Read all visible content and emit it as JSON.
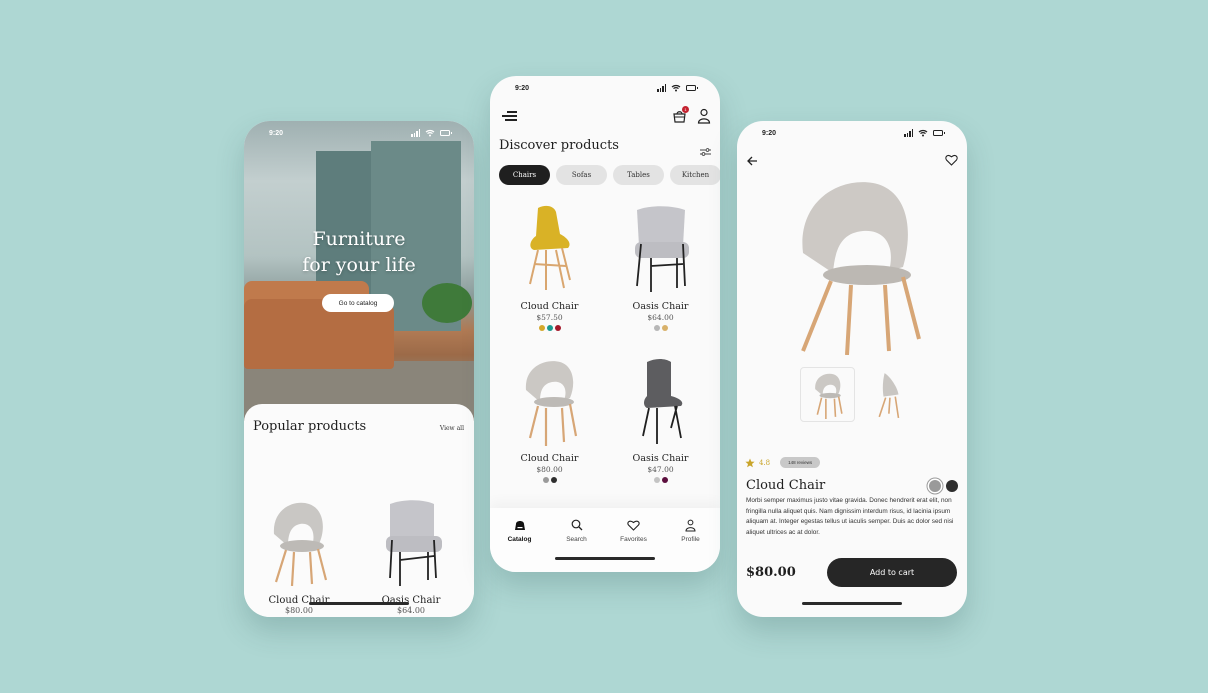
{
  "status_bar": {
    "time": "9:20"
  },
  "home": {
    "hero_title_line1": "Furniture",
    "hero_title_line2": "for your life",
    "cta_label": "Go to catalog",
    "section_title": "Popular products",
    "view_all_label": "View all",
    "products": [
      {
        "name": "Cloud Chair",
        "price": "$80.00",
        "swatches": [
          "#9a9a9a",
          "#2a2a2a"
        ]
      },
      {
        "name": "Oasis Chair",
        "price": "$64.00",
        "swatches": [
          "#9a9a9a",
          "#2a2a2a"
        ]
      }
    ]
  },
  "catalog": {
    "cart_count": "1",
    "title": "Discover products",
    "categories": [
      {
        "label": "Chairs",
        "active": true
      },
      {
        "label": "Sofas",
        "active": false
      },
      {
        "label": "Tables",
        "active": false
      },
      {
        "label": "Kitchen",
        "active": false
      }
    ],
    "products": [
      {
        "name": "Cloud Chair",
        "price": "$57.50",
        "swatches": [
          "#d4a82b",
          "#1b9a8f",
          "#a3182a"
        ]
      },
      {
        "name": "Oasis Chair",
        "price": "$64.00",
        "swatches": [
          "#b7b7b7",
          "#d8b16a"
        ]
      },
      {
        "name": "Cloud Chair",
        "price": "$80.00",
        "swatches": [
          "#9a9a9a",
          "#2e2e2e"
        ]
      },
      {
        "name": "Oasis Chair",
        "price": "$47.00",
        "swatches": [
          "#c4c4c4",
          "#5c0f3e"
        ]
      }
    ],
    "tabs": [
      {
        "label": "Catalog",
        "icon": "sofa-icon",
        "active": true
      },
      {
        "label": "Search",
        "icon": "search-icon",
        "active": false
      },
      {
        "label": "Favorites",
        "icon": "heart-icon",
        "active": false
      },
      {
        "label": "Profile",
        "icon": "user-icon",
        "active": false
      }
    ]
  },
  "detail": {
    "rating": "4.8",
    "reviews_label": "148 reviews",
    "name": "Cloud Chair",
    "colors": [
      "#9a9a9a",
      "#2e2e2e"
    ],
    "description": "Morbi semper maximus justo vitae gravida. Donec hendrerit erat elit, non fringilla nulla aliquet quis. Nam dignissim interdum risus, id lacinia ipsum aliquam at. Integer egestas tellus ut iaculis semper. Duis ac dolor sed nisi aliquet ultrices ac at dolor.",
    "price": "$80.00",
    "add_to_cart_label": "Add to cart"
  },
  "colors": {
    "background": "#aed7d3",
    "primary_dark": "#262626",
    "rating_gold": "#c9a52b",
    "badge_red": "#c4222f"
  }
}
